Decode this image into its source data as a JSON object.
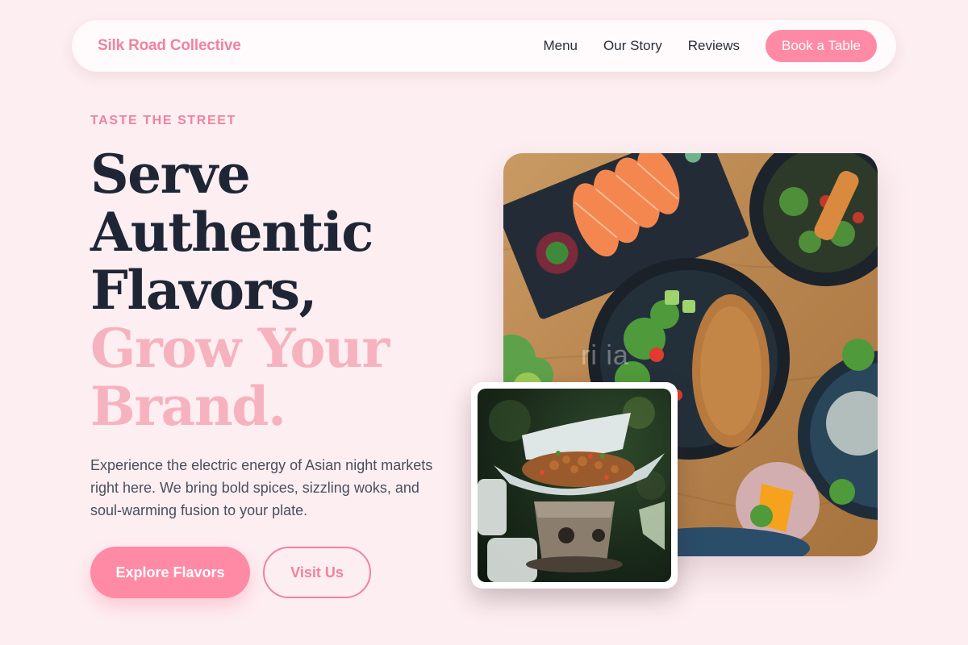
{
  "nav": {
    "brand": "Silk Road Collective",
    "links": [
      "Menu",
      "Our Story",
      "Reviews"
    ],
    "cta": "Book a Table"
  },
  "hero": {
    "eyebrow": "TASTE THE STREET",
    "headline_dark": [
      "Serve",
      "Authentic",
      "Flavors,"
    ],
    "headline_accent": [
      "Grow Your",
      "Brand."
    ],
    "description": "Experience the electric energy of Asian night markets right here. We bring bold spices, sizzling woks, and soul-warming fusion to your plate.",
    "primary_button": "Explore Flavors",
    "secondary_button": "Visit Us"
  },
  "images": {
    "main_watermark": "ri      ia",
    "main_alt": "food-spread-photo",
    "inset_alt": "wok-dish-photo"
  },
  "colors": {
    "background": "#fdeef1",
    "accent": "#ff8aa5",
    "brand_text": "#f0839f",
    "headline_dark": "#1e2636",
    "headline_accent": "#f7b2bf"
  }
}
